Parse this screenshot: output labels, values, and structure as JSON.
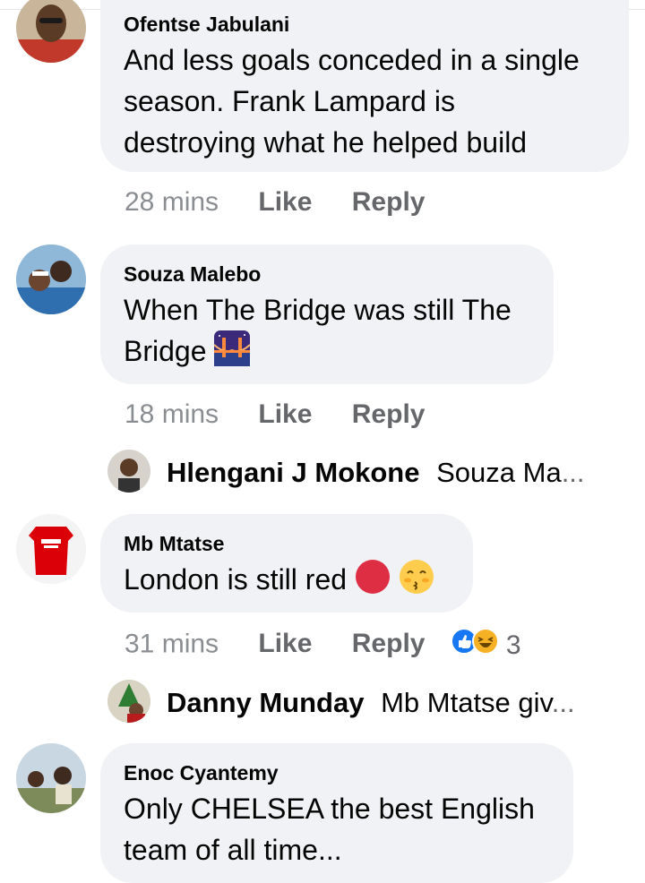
{
  "comments": [
    {
      "author": "Ofentse Jabulani",
      "text_lines": [
        "And less goals conceded in a single",
        "season. Frank Lampard is",
        "destroying what he helped build"
      ],
      "time": "28 mins",
      "like": "Like",
      "reply": "Reply"
    },
    {
      "author": "Souza Malebo",
      "text_lines": [
        "When The Bridge was still The",
        "Bridge"
      ],
      "emoji": "bridge-at-night-emoji",
      "time": "18 mins",
      "like": "Like",
      "reply": "Reply",
      "reply_preview": {
        "name": "Hlengani J Mokone",
        "text": "Souza Ma",
        "ellipsis": "..."
      }
    },
    {
      "author": "Mb Mtatse",
      "text_lines": [
        "London is still red"
      ],
      "emojis": [
        "red-circle-emoji",
        "kissing-smiling-eyes-emoji"
      ],
      "time": "31 mins",
      "like": "Like",
      "reply": "Reply",
      "reaction_icons": [
        "like-reaction-icon",
        "laugh-reaction-icon"
      ],
      "reaction_count": "3",
      "reply_preview": {
        "name": "Danny Munday",
        "text": "Mb Mtatse  giv",
        "ellipsis": "..."
      }
    },
    {
      "author": "Enoc Cyantemy",
      "text_lines": [
        "Only CHELSEA  the best English",
        "team of all time..."
      ]
    }
  ],
  "colors": {
    "bubble": "#f0f2f5",
    "meta": "#65676b",
    "like_reaction": "#1877f2",
    "laugh_reaction": "#f7b125",
    "red_circle": "#dd2e44"
  }
}
